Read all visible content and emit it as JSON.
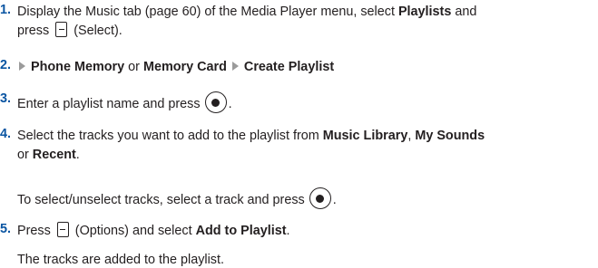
{
  "steps": [
    {
      "number": "1.",
      "line1": [
        "Display the Music tab (page 60) of the Media Player menu, select ",
        "Playlists",
        " and"
      ],
      "line2": [
        "press ",
        "(Select)."
      ]
    },
    {
      "number": "2.",
      "parts": [
        "Phone Memory",
        " or ",
        "Memory Card",
        "Create Playlist"
      ]
    },
    {
      "number": "3.",
      "text": "Enter a playlist name and press",
      "end": "."
    },
    {
      "number": "4.",
      "line1": [
        "Select the tracks you want to add to the playlist from ",
        "Music Library",
        ", ",
        "My Sounds"
      ],
      "line2": [
        "or ",
        "Recent",
        "."
      ],
      "note": [
        "To select/unselect tracks, select a track and press",
        "."
      ]
    },
    {
      "number": "5.",
      "parts": [
        "Press ",
        "(Options) and select ",
        "Add to Playlist",
        "."
      ],
      "note": "The tracks are added to the playlist."
    }
  ],
  "icons": {
    "arrow": "triangle-right-icon",
    "softkey": "left-softkey-icon",
    "center": "center-key-icon"
  }
}
